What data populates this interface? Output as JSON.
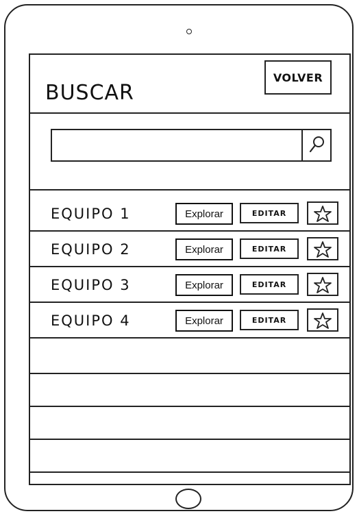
{
  "header": {
    "title": "BUSCAR",
    "back_label": "VOLVER"
  },
  "search": {
    "value": "",
    "placeholder": "",
    "button_icon": "search-icon"
  },
  "teams": [
    {
      "name": "EQUIPO 1",
      "explore_label": "Explorar",
      "edit_label": "EDITAR",
      "favorite_icon": "star-icon"
    },
    {
      "name": "EQUIPO 2",
      "explore_label": "Explorar",
      "edit_label": "EDITAR",
      "favorite_icon": "star-icon"
    },
    {
      "name": "EQUIPO 3",
      "explore_label": "Explorar",
      "edit_label": "EDITAR",
      "favorite_icon": "star-icon"
    },
    {
      "name": "EQUIPO 4",
      "explore_label": "Explorar",
      "edit_label": "EDITAR",
      "favorite_icon": "star-icon"
    }
  ],
  "device": {
    "camera_icon": "camera-icon",
    "home_icon": "home-button-icon"
  },
  "colors": {
    "ink": "#222222",
    "background": "#ffffff"
  }
}
